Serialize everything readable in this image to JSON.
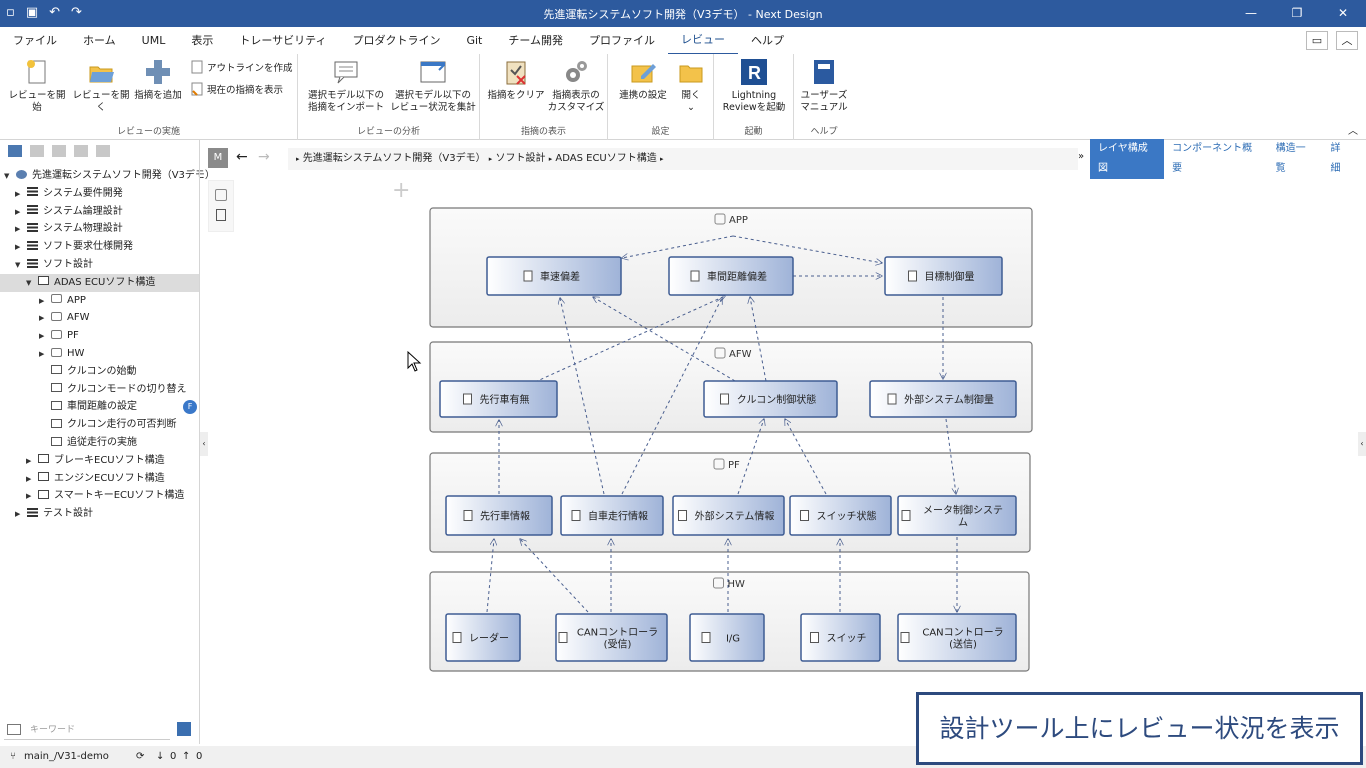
{
  "window": {
    "title": "先進運転システムソフト開発（V3デモ） - Next Design"
  },
  "menu": [
    "ファイル",
    "ホーム",
    "UML",
    "表示",
    "トレーサビリティ",
    "プロダクトライン",
    "Git",
    "チーム開発",
    "プロファイル",
    "レビュー",
    "ヘルプ"
  ],
  "ribbon": {
    "groups": [
      {
        "label": "レビューの実施",
        "buttons": [
          "レビューを開始",
          "レビューを開く",
          "指摘を追加"
        ],
        "small": [
          "アウトラインを作成",
          "現在の指摘を表示"
        ]
      },
      {
        "label": "レビューの分析",
        "buttons": [
          [
            "選択モデル以下の",
            "指摘をインポート"
          ],
          [
            "選択モデル以下の",
            "レビュー状況を集計"
          ]
        ]
      },
      {
        "label": "指摘の表示",
        "buttons": [
          "指摘をクリア",
          [
            "指摘表示の",
            "カスタマイズ"
          ]
        ]
      },
      {
        "label": "設定",
        "buttons": [
          "連携の設定",
          "開く"
        ]
      },
      {
        "label": "起動",
        "buttons": [
          [
            "Lightning",
            "Reviewを起動"
          ]
        ]
      },
      {
        "label": "ヘルプ",
        "buttons": [
          [
            "ユーザーズ",
            "マニュアル"
          ]
        ]
      }
    ]
  },
  "tree": [
    {
      "label": "先進運転システムソフト開発（V3デモ）",
      "level": 0,
      "icon": "project-icon",
      "expanded": true
    },
    {
      "label": "システム要件開発",
      "level": 1,
      "icon": "list-icon",
      "expanded": false
    },
    {
      "label": "システム論理設計",
      "level": 1,
      "icon": "list-icon",
      "expanded": false
    },
    {
      "label": "システム物理設計",
      "level": 1,
      "icon": "list-icon",
      "expanded": false
    },
    {
      "label": "ソフト要求仕様開発",
      "level": 1,
      "icon": "list-icon",
      "expanded": false
    },
    {
      "label": "ソフト設計",
      "level": 1,
      "icon": "list-icon",
      "expanded": true
    },
    {
      "label": "ADAS ECUソフト構造",
      "level": 2,
      "icon": "structure-icon",
      "expanded": true,
      "selected": true
    },
    {
      "label": "APP",
      "level": 3,
      "icon": "layer-icon",
      "expanded": false
    },
    {
      "label": "AFW",
      "level": 3,
      "icon": "layer-icon",
      "expanded": false
    },
    {
      "label": "PF",
      "level": 3,
      "icon": "layer-icon",
      "expanded": false
    },
    {
      "label": "HW",
      "level": 3,
      "icon": "layer-icon",
      "expanded": false
    },
    {
      "label": "クルコンの始動",
      "level": 3,
      "icon": "sequence-icon"
    },
    {
      "label": "クルコンモードの切り替え",
      "level": 3,
      "icon": "sequence-icon"
    },
    {
      "label": "車間距離の設定",
      "level": 3,
      "icon": "sequence-icon",
      "badge": "F"
    },
    {
      "label": "クルコン走行の可否判断",
      "level": 3,
      "icon": "sequence-icon"
    },
    {
      "label": "追従走行の実施",
      "level": 3,
      "icon": "sequence-icon"
    },
    {
      "label": "ブレーキECUソフト構造",
      "level": 2,
      "icon": "structure-icon",
      "expanded": false
    },
    {
      "label": "エンジンECUソフト構造",
      "level": 2,
      "icon": "structure-icon",
      "expanded": false
    },
    {
      "label": "スマートキーECUソフト構造",
      "level": 2,
      "icon": "structure-icon",
      "expanded": false
    },
    {
      "label": "テスト設計",
      "level": 1,
      "icon": "list-icon",
      "expanded": false
    }
  ],
  "search": {
    "placeholder": "キーワード"
  },
  "nav": {
    "badge": "M",
    "breadcrumbs": [
      "先進運転システムソフト開発（V3デモ）",
      "ソフト設計",
      "ADAS ECUソフト構造"
    ],
    "tabs": [
      "レイヤ構成図",
      "コンポーネント概要",
      "構造一覧",
      "詳細"
    ]
  },
  "diagram": {
    "layers": [
      "APP",
      "AFW",
      "PF",
      "HW"
    ],
    "components": {
      "app1": "車速偏差",
      "app2": "車間距離偏差",
      "app3": "目標制御量",
      "afw1": "先行車有無",
      "afw2": "クルコン制御状態",
      "afw3": "外部システム制御量",
      "pf1": "先行車情報",
      "pf2": "自車走行情報",
      "pf3": "外部システム情報",
      "pf4": "スイッチ状態",
      "pf5": "メータ制御システム",
      "hw1": "レーダー",
      "hw2": "CANコントローラ(受信)",
      "hw3": "I/G",
      "hw4": "スイッチ",
      "hw5": "CANコントローラ(送信)"
    }
  },
  "status": {
    "branch": "main_/V31-demo",
    "down": "0",
    "up": "0"
  },
  "overlay": "設計ツール上にレビュー状況を表示"
}
